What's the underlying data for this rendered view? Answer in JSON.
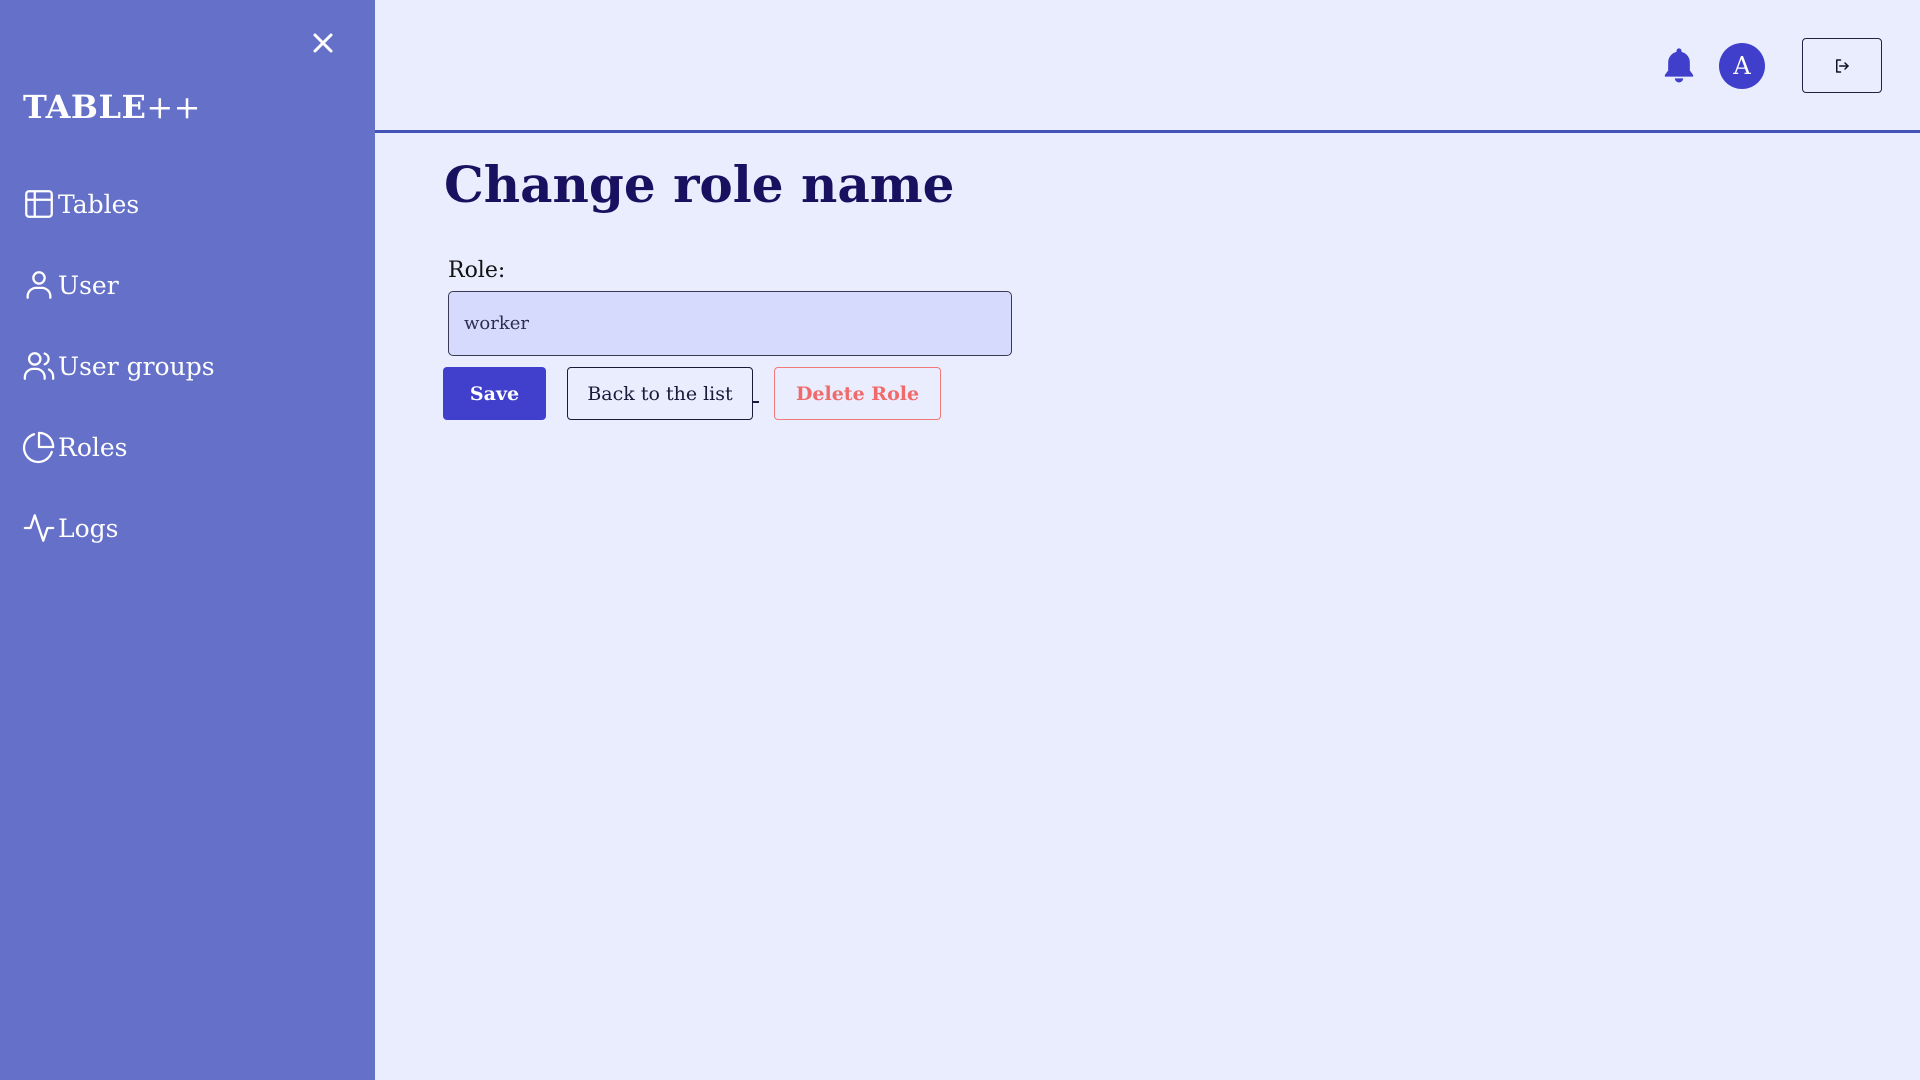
{
  "sidebar": {
    "brand": "TABLE",
    "brand_suffix": "++",
    "items": [
      {
        "label": "Tables",
        "icon": "table-icon"
      },
      {
        "label": "User",
        "icon": "user-icon"
      },
      {
        "label": "User groups",
        "icon": "users-icon"
      },
      {
        "label": "Roles",
        "icon": "pie-chart-icon"
      },
      {
        "label": "Logs",
        "icon": "activity-icon"
      }
    ]
  },
  "header": {
    "avatar_initial": "A"
  },
  "main": {
    "title": "Change role name",
    "role_label": "Role:",
    "role_value": "worker",
    "save_label": "Save",
    "back_label": "Back to the list",
    "delete_label": "Delete Role"
  },
  "colors": {
    "sidebar_bg": "#6570c9",
    "page_bg": "#eaedfe",
    "primary": "#4040cc",
    "danger": "#f06a6a",
    "title": "#1a1060"
  }
}
